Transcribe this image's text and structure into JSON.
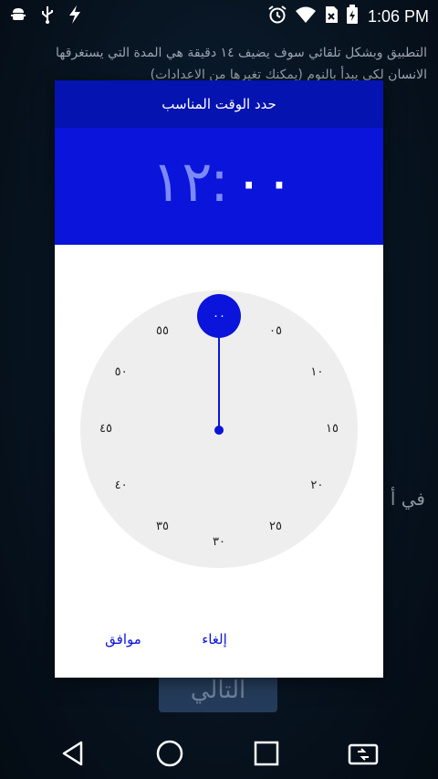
{
  "status_bar": {
    "time": "1:06 PM",
    "left_icons": [
      "android-debug-icon",
      "usb-icon",
      "flash-icon"
    ],
    "right_icons": [
      "alarm-icon",
      "wifi-icon",
      "sim-icon",
      "battery-icon"
    ]
  },
  "background": {
    "line1": "التطبيق وبشكل تلقائي سوف يضيف ١٤ دقيقة هي المدة التي يستغرقها",
    "line2": "الانسان لكي يبدأ بالنوم (يمكنك تغيرها من الاعدادات)",
    "side_text": "في أ",
    "next_button_label": "التالي"
  },
  "dialog": {
    "title": "حدد الوقت المناسب",
    "hours": "١٢",
    "separator": ":",
    "minutes": "٠٠",
    "selected_minute_label": "٠٠",
    "clock_numbers": [
      {
        "label": "٠٥"
      },
      {
        "label": "١٠"
      },
      {
        "label": "١٥"
      },
      {
        "label": "٢٠"
      },
      {
        "label": "٢٥"
      },
      {
        "label": "٣٠"
      },
      {
        "label": "٣٥"
      },
      {
        "label": "٤٠"
      },
      {
        "label": "٤٥"
      },
      {
        "label": "٥٠"
      },
      {
        "label": "٥٥"
      }
    ],
    "ok_label": "موافق",
    "cancel_label": "إلغاء"
  },
  "colors": {
    "primary": "#0a14db",
    "title_bar": "#0513b0"
  },
  "nav_bar": {
    "icons": [
      "back-icon",
      "home-icon",
      "recents-icon",
      "switch-app-icon"
    ]
  }
}
